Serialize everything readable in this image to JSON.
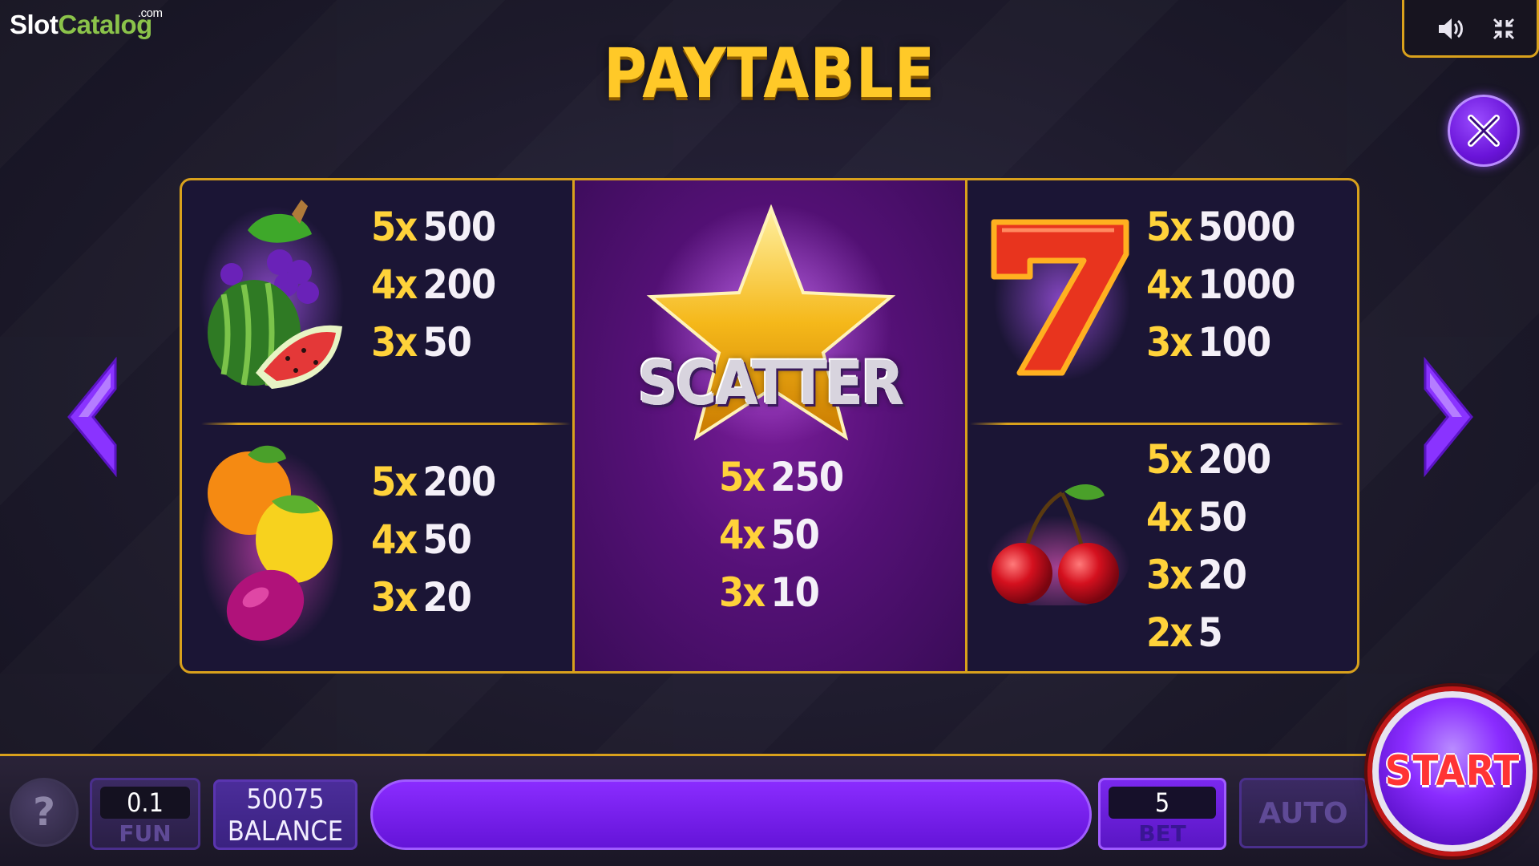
{
  "logo": {
    "text_main": "Slot",
    "text_accent": "Catalog",
    "suffix": ".com"
  },
  "title": "PAYTABLE",
  "controls": {
    "sound_icon": "speaker-icon",
    "minimize_icon": "minimize-icon",
    "close_icon": "close-icon"
  },
  "navigation": {
    "prev_icon": "chevron-left-icon",
    "next_icon": "chevron-right-icon"
  },
  "paytable": {
    "fruits_top": {
      "symbol": "grapes-watermelon",
      "pays": [
        {
          "mult": "5x",
          "value": "500"
        },
        {
          "mult": "4x",
          "value": "200"
        },
        {
          "mult": "3x",
          "value": "50"
        }
      ]
    },
    "fruits_bottom": {
      "symbol": "orange-lemon-plum",
      "pays": [
        {
          "mult": "5x",
          "value": "200"
        },
        {
          "mult": "4x",
          "value": "50"
        },
        {
          "mult": "3x",
          "value": "20"
        }
      ]
    },
    "scatter": {
      "label": "SCATTER",
      "pays": [
        {
          "mult": "5x",
          "value": "250"
        },
        {
          "mult": "4x",
          "value": "50"
        },
        {
          "mult": "3x",
          "value": "10"
        }
      ]
    },
    "seven": {
      "symbol": "seven",
      "pays": [
        {
          "mult": "5x",
          "value": "5000"
        },
        {
          "mult": "4x",
          "value": "1000"
        },
        {
          "mult": "3x",
          "value": "100"
        }
      ]
    },
    "cherry": {
      "symbol": "cherry",
      "pays": [
        {
          "mult": "5x",
          "value": "200"
        },
        {
          "mult": "4x",
          "value": "50"
        },
        {
          "mult": "3x",
          "value": "20"
        },
        {
          "mult": "2x",
          "value": "5"
        }
      ]
    }
  },
  "bottom": {
    "help_label": "?",
    "coin": {
      "value": "0.1",
      "label": "FUN"
    },
    "balance": {
      "value": "50075",
      "label": "BALANCE"
    },
    "bet": {
      "value": "5",
      "label": "BET"
    },
    "auto_label": "AUTO",
    "start_label": "START"
  },
  "colors": {
    "gold": "#d9a11c",
    "title": "#ffc928",
    "purple": "#8a2cff",
    "start_text": "#ff3434"
  }
}
